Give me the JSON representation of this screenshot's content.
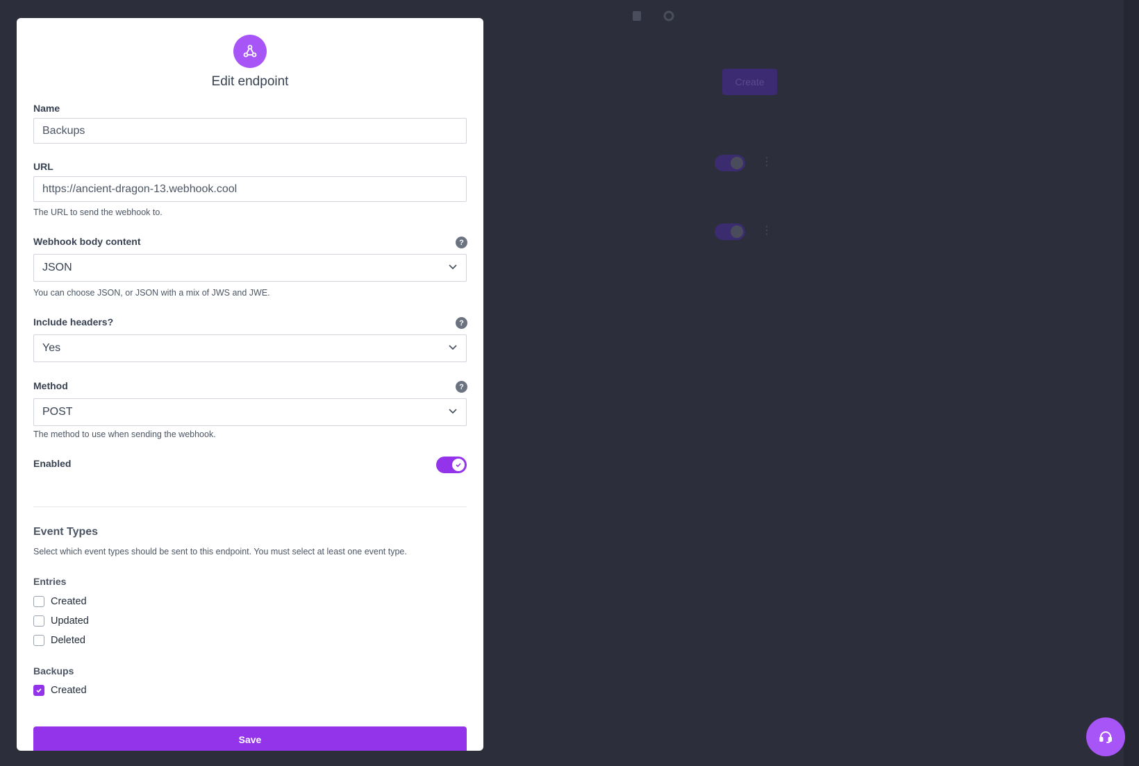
{
  "background": {
    "create_label": "Create"
  },
  "modal": {
    "title": "Edit endpoint",
    "header_icon": "webhook-icon",
    "name": {
      "label": "Name",
      "value": "Backups"
    },
    "url": {
      "label": "URL",
      "value": "https://ancient-dragon-13.webhook.cool",
      "hint": "The URL to send the webhook to."
    },
    "body_content": {
      "label": "Webhook body content",
      "selected": "JSON",
      "hint": "You can choose JSON, or JSON with a mix of JWS and JWE."
    },
    "include_headers": {
      "label": "Include headers?",
      "selected": "Yes"
    },
    "method": {
      "label": "Method",
      "selected": "POST",
      "hint": "The method to use when sending the webhook."
    },
    "enabled": {
      "label": "Enabled",
      "on": true
    },
    "event_types": {
      "title": "Event Types",
      "description": "Select which event types should be sent to this endpoint. You must select at least one event type.",
      "groups": [
        {
          "title": "Entries",
          "items": [
            {
              "label": "Created",
              "checked": false
            },
            {
              "label": "Updated",
              "checked": false
            },
            {
              "label": "Deleted",
              "checked": false
            }
          ]
        },
        {
          "title": "Backups",
          "items": [
            {
              "label": "Created",
              "checked": true
            }
          ]
        }
      ]
    },
    "save_label": "Save"
  },
  "colors": {
    "accent": "#9333ea",
    "accent_light": "#a855f7",
    "backdrop": "#2c2e3b"
  }
}
